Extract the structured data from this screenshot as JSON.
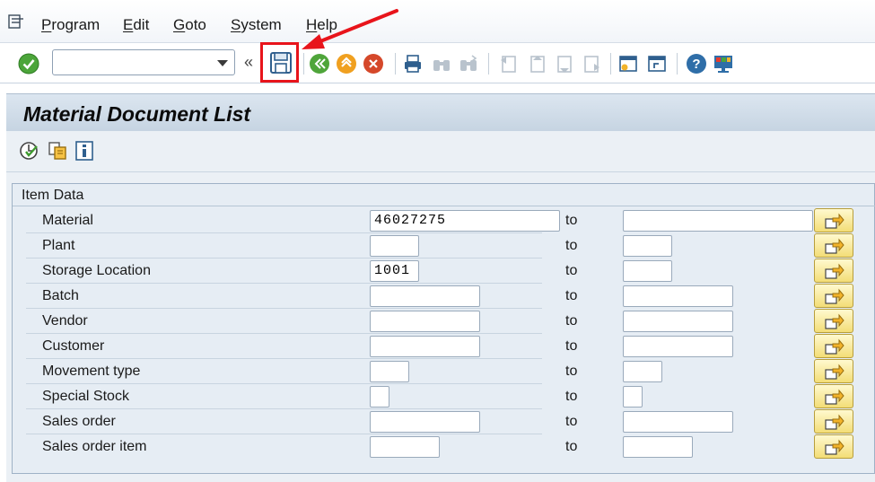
{
  "menubar": {
    "icon": "menu-exit-icon",
    "items": [
      {
        "label": "Program",
        "accel": "P",
        "rest": "rogram"
      },
      {
        "label": "Edit",
        "accel": "E",
        "rest": "dit"
      },
      {
        "label": "Goto",
        "accel": "G",
        "rest": "oto"
      },
      {
        "label": "System",
        "accel": "S",
        "rest": "ystem"
      },
      {
        "label": "Help",
        "accel": "H",
        "rest": "elp"
      }
    ]
  },
  "toolbar": {
    "command_value": "",
    "collapse_label": "«",
    "icons": [
      "enter-icon",
      "save-icon",
      "back-icon",
      "exit-icon",
      "cancel-icon",
      "print-icon",
      "find-icon",
      "find-next-icon",
      "first-page-icon",
      "previous-page-icon",
      "next-page-icon",
      "last-page-icon",
      "create-session-icon",
      "shortcut-icon",
      "help-icon",
      "customize-layout-icon"
    ]
  },
  "page": {
    "title": "Material Document List",
    "app_icons": [
      "execute-icon",
      "copy-variant-icon",
      "info-icon"
    ]
  },
  "group": {
    "title": "Item Data",
    "to_label": "to",
    "rows": [
      {
        "label": "Material",
        "from": "46027275",
        "to": ""
      },
      {
        "label": "Plant",
        "from": "",
        "to": ""
      },
      {
        "label": "Storage Location",
        "from": "1001",
        "to": ""
      },
      {
        "label": "Batch",
        "from": "",
        "to": ""
      },
      {
        "label": "Vendor",
        "from": "",
        "to": ""
      },
      {
        "label": "Customer",
        "from": "",
        "to": ""
      },
      {
        "label": "Movement type",
        "from": "",
        "to": ""
      },
      {
        "label": "Special Stock",
        "from": "",
        "to": ""
      },
      {
        "label": "Sales order",
        "from": "",
        "to": ""
      },
      {
        "label": "Sales order item",
        "from": "",
        "to": ""
      }
    ]
  },
  "colors": {
    "highlight": "#e8141b",
    "title_bar": "#c6d4e2",
    "multiple_selection": "#f3dd76"
  }
}
